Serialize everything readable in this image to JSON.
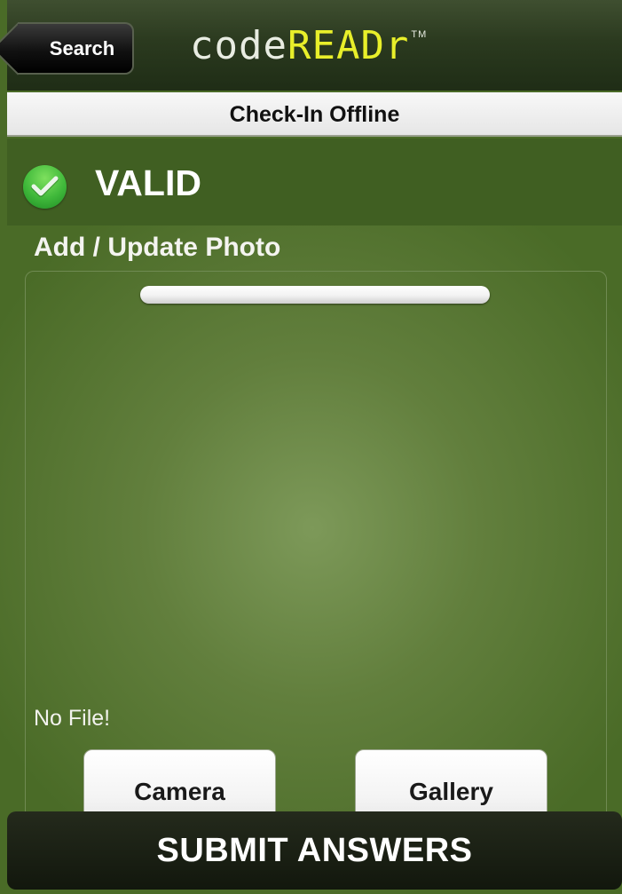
{
  "nav": {
    "back_label": "Search",
    "logo_code": "code",
    "logo_reader": "READr",
    "logo_tm": "TM"
  },
  "subtitle": "Check-In Offline",
  "status": {
    "icon": "checkmark-icon",
    "text": "VALID",
    "color": "#3fb83a"
  },
  "photo": {
    "title": "Add / Update Photo",
    "file_status": "No File!",
    "camera_label": "Camera",
    "gallery_label": "Gallery"
  },
  "submit_label": "SUBMIT ANSWERS",
  "colors": {
    "background": "#627f3d",
    "logo_accent": "#e8ef2a",
    "nav_bar": "#2b3a1f"
  }
}
